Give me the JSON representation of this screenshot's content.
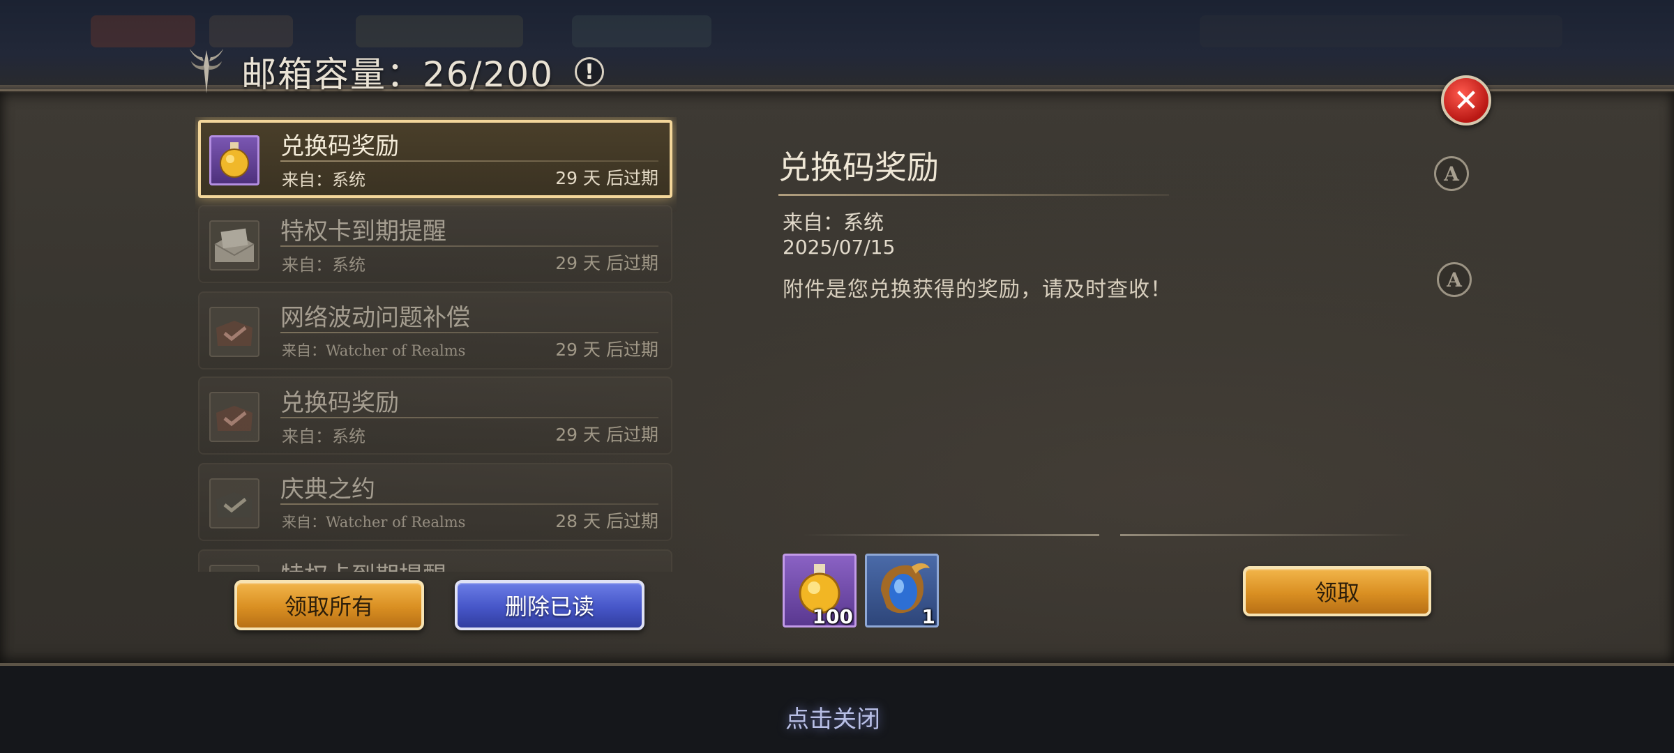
{
  "header": {
    "title": "邮箱容量：26/200",
    "info_icon_glyph": "!",
    "emblem_icon": "winged-emblem-icon"
  },
  "close_icon_glyph": "✕",
  "mail_list": [
    {
      "title": "兑换码奖励",
      "from": "来自：系统",
      "expire": "29 天 后过期",
      "icon": "potion-icon",
      "selected": true
    },
    {
      "title": "特权卡到期提醒",
      "from": "来自：系统",
      "expire": "29 天 后过期",
      "icon": "envelope-icon",
      "selected": false
    },
    {
      "title": "网络波动问题补偿",
      "from": "来自：Watcher of Realms",
      "expire": "29 天 后过期",
      "icon": "envelope-check-icon",
      "selected": false
    },
    {
      "title": "兑换码奖励",
      "from": "来自：系统",
      "expire": "29 天 后过期",
      "icon": "envelope-check-icon",
      "selected": false
    },
    {
      "title": "庆典之约",
      "from": "来自：Watcher of Realms",
      "expire": "28 天 后过期",
      "icon": "envelope-check-icon",
      "selected": false
    },
    {
      "title": "特权卡到期提醒",
      "from": "",
      "expire": "",
      "icon": "envelope-icon",
      "selected": false
    }
  ],
  "buttons": {
    "claim_all": "领取所有",
    "delete_read": "删除已读",
    "claim": "领取"
  },
  "detail": {
    "title": "兑换码奖励",
    "from": "来自：系统",
    "date": "2025/07/15",
    "body": "附件是您兑换获得的奖励，请及时查收！",
    "badge_glyph": "A"
  },
  "attachments": [
    {
      "icon": "gold-potion-icon",
      "count": "100",
      "rarity_color": "#8a62c4"
    },
    {
      "icon": "blue-gem-amulet-icon",
      "count": "1",
      "rarity_color": "#4a6aa8"
    }
  ],
  "close_hint": "点击关闭",
  "colors": {
    "gold_button": "#d98f22",
    "blue_button": "#4656c8",
    "close_button": "#b91814",
    "selected_glow": "#f3d69a"
  }
}
